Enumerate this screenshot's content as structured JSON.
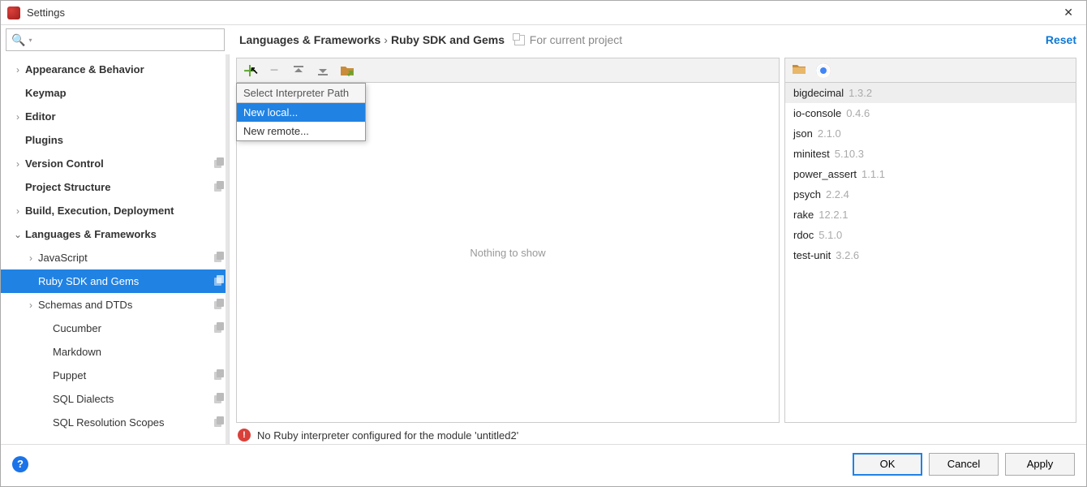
{
  "window": {
    "title": "Settings"
  },
  "breadcrumb": {
    "a": "Languages & Frameworks",
    "b": "Ruby SDK and Gems",
    "project_hint": "For current project",
    "reset": "Reset"
  },
  "sidebar": {
    "items": [
      {
        "label": "Appearance & Behavior",
        "bold": true,
        "arrow": true
      },
      {
        "label": "Keymap",
        "bold": true
      },
      {
        "label": "Editor",
        "bold": true,
        "arrow": true
      },
      {
        "label": "Plugins",
        "bold": true
      },
      {
        "label": "Version Control",
        "bold": true,
        "arrow": true,
        "copy": true
      },
      {
        "label": "Project Structure",
        "bold": true,
        "copy": true
      },
      {
        "label": "Build, Execution, Deployment",
        "bold": true,
        "arrow": true
      },
      {
        "label": "Languages & Frameworks",
        "bold": true,
        "arrow": true,
        "open": true
      },
      {
        "label": "JavaScript",
        "lv": 1,
        "arrow": true,
        "copy": true
      },
      {
        "label": "Ruby SDK and Gems",
        "lv": 1,
        "selected": true,
        "copy": true
      },
      {
        "label": "Schemas and DTDs",
        "lv": 1,
        "arrow": true,
        "copy": true
      },
      {
        "label": "Cucumber",
        "lv": 2,
        "copy": true
      },
      {
        "label": "Markdown",
        "lv": 2
      },
      {
        "label": "Puppet",
        "lv": 2,
        "copy": true
      },
      {
        "label": "SQL Dialects",
        "lv": 2,
        "copy": true
      },
      {
        "label": "SQL Resolution Scopes",
        "lv": 2,
        "copy": true
      }
    ]
  },
  "interpreter_panel": {
    "empty_msg": "Nothing to show",
    "popup_header": "Select Interpreter Path",
    "popup_items": [
      "New local...",
      "New remote..."
    ]
  },
  "gems": [
    {
      "name": "bigdecimal",
      "ver": "1.3.2",
      "hl": true
    },
    {
      "name": "io-console",
      "ver": "0.4.6"
    },
    {
      "name": "json",
      "ver": "2.1.0"
    },
    {
      "name": "minitest",
      "ver": "5.10.3"
    },
    {
      "name": "power_assert",
      "ver": "1.1.1"
    },
    {
      "name": "psych",
      "ver": "2.2.4"
    },
    {
      "name": "rake",
      "ver": "12.2.1"
    },
    {
      "name": "rdoc",
      "ver": "5.1.0"
    },
    {
      "name": "test-unit",
      "ver": "3.2.6"
    }
  ],
  "status_msg": "No Ruby interpreter configured for the module 'untitled2'",
  "buttons": {
    "ok": "OK",
    "cancel": "Cancel",
    "apply": "Apply"
  }
}
